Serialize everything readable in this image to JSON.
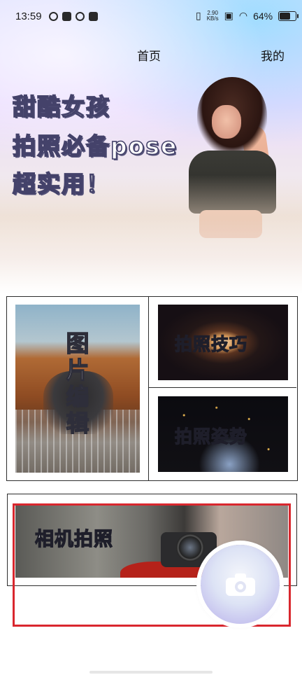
{
  "status_bar": {
    "time": "13:59",
    "net_speed_top": "2.90",
    "net_speed_bottom": "KB/s",
    "battery_percent": "64%",
    "battery_level": 0.64
  },
  "nav": {
    "home": "首页",
    "mine": "我的"
  },
  "hero": {
    "line1": "甜酷女孩",
    "line2": "拍照必备pose",
    "line3": "超实用！"
  },
  "tiles": {
    "edit_chars": [
      "图",
      "片",
      "编",
      "辑"
    ],
    "tips": "拍照技巧",
    "pose": "拍照姿势"
  },
  "camera": {
    "label": "相机拍照"
  },
  "colors": {
    "highlight": "#d9272e",
    "headline_stroke": "#44426a"
  }
}
